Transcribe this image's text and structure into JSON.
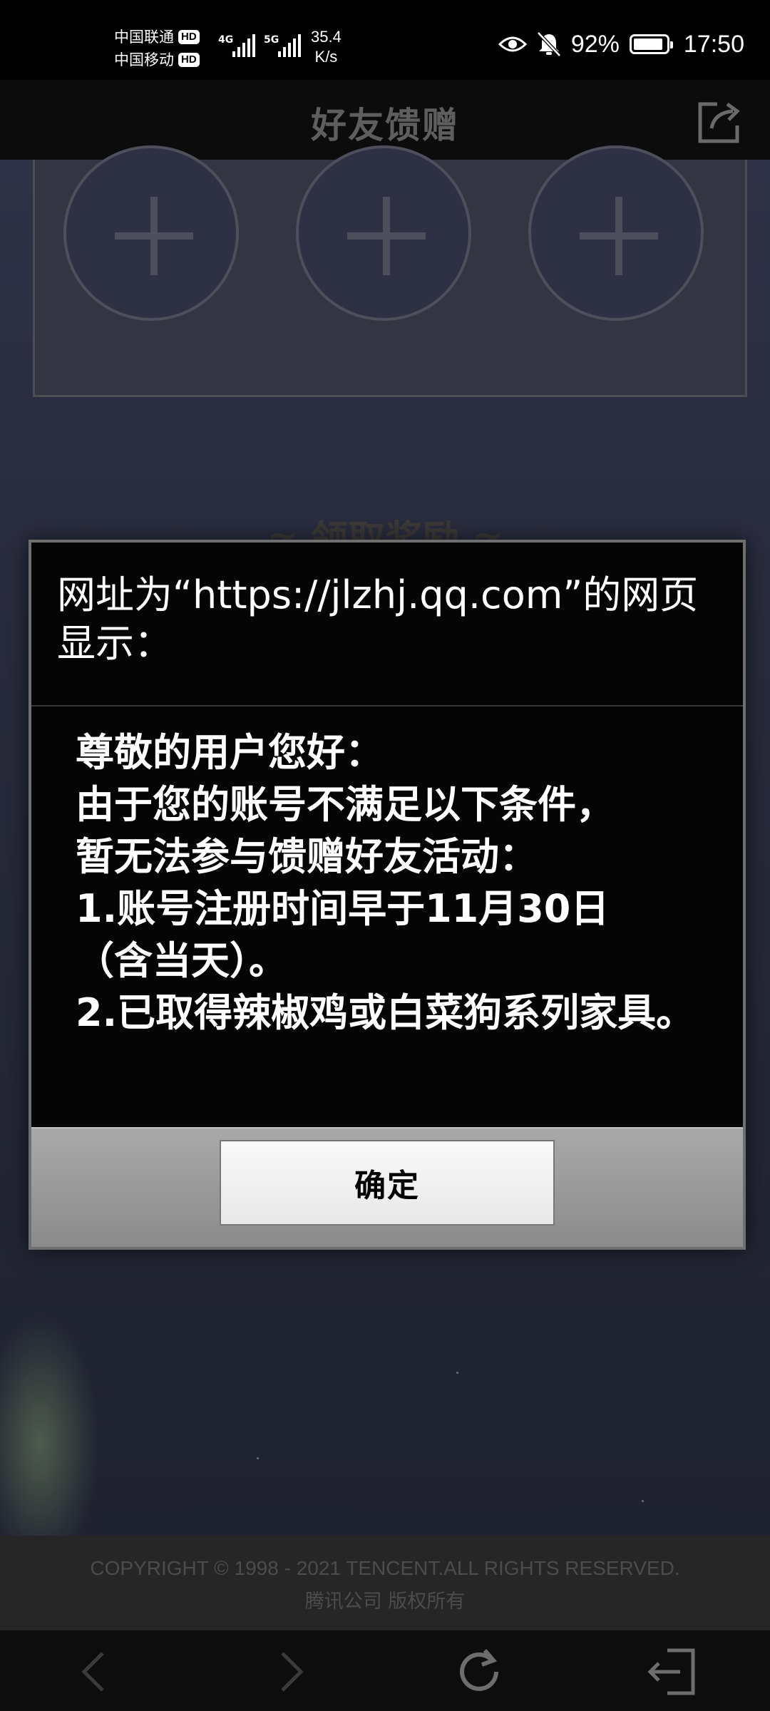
{
  "status_bar": {
    "carrier1": "中国联通",
    "carrier2": "中国移动",
    "hd_label": "HD",
    "net1": "4G",
    "net2": "5G",
    "speed_value": "35.4",
    "speed_unit": "K/s",
    "battery_pct": "92%",
    "battery_level": 0.92,
    "time": "17:50",
    "icons": [
      "eye-icon",
      "mute-bell-icon",
      "battery-icon"
    ]
  },
  "header": {
    "title": "好友馈赠",
    "share_icon": "share-icon"
  },
  "page": {
    "section_title": "≈ 领取奖励 ≈",
    "slots": [
      "add-slot-1",
      "add-slot-2",
      "add-slot-3"
    ]
  },
  "dialog": {
    "title": "网址为“https://jlzhj.qq.com”的网页显示：",
    "message": "尊敬的用户您好：\n由于您的账号不满足以下条件，\n暂无法参与馈赠好友活动：\n1.账号注册时间早于11月30日\n（含当天）。\n2.已取得辣椒鸡或白菜狗系列家具。",
    "ok_label": "确定"
  },
  "footer": {
    "copyright": "COPYRIGHT © 1998 - 2021 TENCENT.ALL RIGHTS RESERVED.",
    "company": "腾讯公司 版权所有"
  },
  "browser_nav": {
    "icons": [
      "back-icon",
      "forward-icon",
      "refresh-icon",
      "exit-icon"
    ]
  }
}
